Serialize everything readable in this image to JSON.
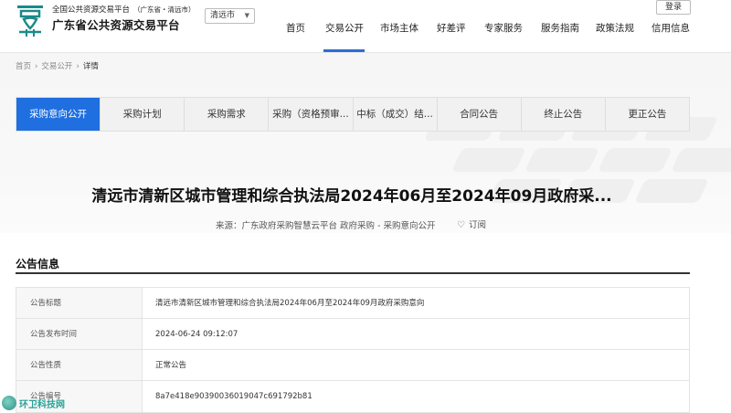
{
  "header": {
    "site_sub": "全国公共资源交易平台",
    "site_region": "（广东省・清远市）",
    "site_title": "广东省公共资源交易平台",
    "city": "清远市",
    "login": "登录",
    "nav": [
      "首页",
      "交易公开",
      "市场主体",
      "好差评",
      "专家服务",
      "服务指南",
      "政策法规",
      "信用信息"
    ],
    "active_nav": "交易公开"
  },
  "breadcrumb": [
    "首页",
    "交易公开",
    "详情"
  ],
  "tabs": [
    "采购意向公开",
    "采购计划",
    "采购需求",
    "采购（资格预审...",
    "中标（成交）结...",
    "合同公告",
    "终止公告",
    "更正公告"
  ],
  "active_tab": "采购意向公开",
  "document": {
    "title": "清远市清新区城市管理和综合执法局2024年06月至2024年09月政府采...",
    "source": "来源：广东政府采购智慧云平台 政府采购 - 采购意向公开",
    "subscribe": "订阅"
  },
  "section": {
    "title": "公告信息",
    "rows": [
      {
        "label": "公告标题",
        "value": "清远市清新区城市管理和综合执法局2024年06月至2024年09月政府采购意向"
      },
      {
        "label": "公告发布时间",
        "value": "2024-06-24 09:12:07"
      },
      {
        "label": "公告性质",
        "value": "正常公告"
      },
      {
        "label": "公告编号",
        "value": "8a7e418e90390036019047c691792b81"
      }
    ]
  },
  "watermark": "环卫科技网",
  "colors": {
    "accent": "#1f6fe0",
    "logo": "#1a8a8a"
  }
}
